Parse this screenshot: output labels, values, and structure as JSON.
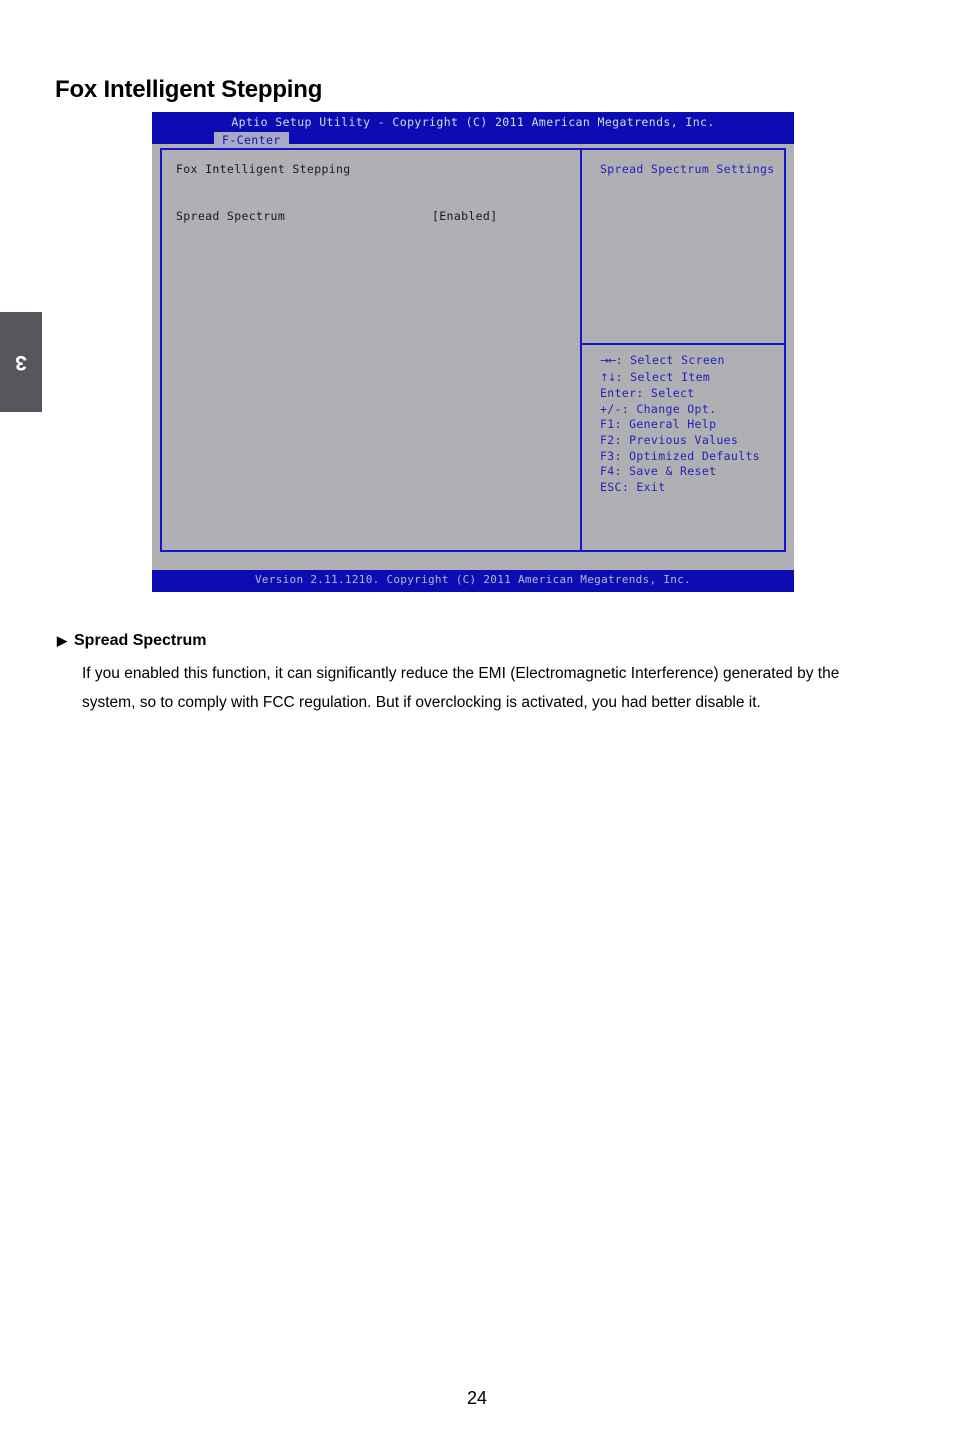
{
  "page": {
    "heading": "Fox Intelligent Stepping",
    "chapter_marker": "3",
    "page_number": "24"
  },
  "bios": {
    "title_bar": "Aptio Setup Utility - Copyright (C) 2011 American Megatrends, Inc.",
    "active_tab": "F-Center",
    "left_panel": {
      "section_title": "Fox Intelligent Stepping",
      "settings": [
        {
          "label": "Spread Spectrum",
          "value": "[Enabled]"
        }
      ]
    },
    "right_panel": {
      "help_title": "Spread Spectrum Settings",
      "key_legend": [
        {
          "glyph": "→←",
          "text": ": Select Screen"
        },
        {
          "glyph": "↑↓",
          "text": ": Select Item"
        },
        {
          "glyph": "",
          "text": "Enter: Select"
        },
        {
          "glyph": "",
          "text": "+/-: Change Opt."
        },
        {
          "glyph": "",
          "text": "F1: General Help"
        },
        {
          "glyph": "",
          "text": "F2: Previous Values"
        },
        {
          "glyph": "",
          "text": "F3: Optimized Defaults"
        },
        {
          "glyph": "",
          "text": "F4: Save & Reset"
        },
        {
          "glyph": "",
          "text": "ESC: Exit"
        }
      ]
    },
    "footer_bar": "Version 2.11.1210. Copyright (C) 2011 American Megatrends, Inc.",
    "colors": {
      "header_blue": "#0c0cb4",
      "panel_gray": "#b0b0b4",
      "border_blue": "#1414c8",
      "help_text_blue": "#2222b8",
      "tab_bg": "#a8a8c8"
    }
  },
  "prose": {
    "bullet_marker": "▶",
    "bullet_title": "Spread Spectrum",
    "paragraph": "If you enabled this function, it can significantly reduce the EMI (Electromagnetic Interference) generated by the system, so to comply with FCC regulation. But if overclocking is activated, you had better disable it."
  }
}
